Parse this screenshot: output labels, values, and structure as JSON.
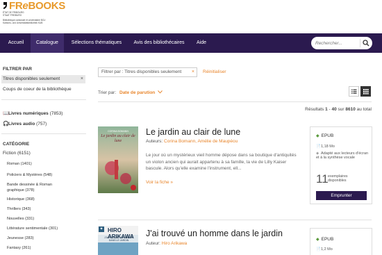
{
  "header": {
    "logo_text_a": "FR",
    "logo_text_e": "e",
    "logo_text_b": "BOOKS",
    "subtitle_lines": [
      "ÉTAT DE FRIBOURG",
      "STAAT FREIBURG",
      "Bibliothèque cantonale et universitaire BCU",
      "Kantons- und Universitätsbibliothek KUB"
    ]
  },
  "nav": {
    "items": [
      "Accueil",
      "Catalogue",
      "Sélections thématiques",
      "Avis des bibliothécaires",
      "Aide"
    ],
    "active": "Catalogue"
  },
  "search": {
    "placeholder": "Rechercher..."
  },
  "sidebar": {
    "filter_heading": "FILTRER PAR",
    "active_filter": "Titres disponibles seulement",
    "remove": "×",
    "favorites": "Coups de coeur de la bibliothèque",
    "formats": [
      {
        "label": "Livres numériques",
        "count": "(7853)"
      },
      {
        "label": "Livres audio",
        "count": "(757)"
      }
    ],
    "category_heading": "CATÉGORIE",
    "category_root": "Fiction (6151)",
    "categories": [
      "Roman (1401)",
      "Policiers & Mystères (548)",
      "Bande dessinée & Roman",
      "graphique (378)",
      "Historique (368)",
      "Thrillers (343)",
      "Nouvelles (331)",
      "Littérature sentimentale (301)",
      "Jeunesse (283)",
      "Fantasy (261)"
    ]
  },
  "filterbar": {
    "chip": "Filtrer par : Titres disponibles seulement",
    "chip_remove": "×",
    "reset": "Réinitialiser"
  },
  "sort": {
    "label": "Trier par:",
    "value": "Date de parution"
  },
  "results": {
    "prefix": "Résultats",
    "from": "1",
    "to": "40",
    "sep": "-",
    "on": "sur",
    "total": "8610",
    "suffix": "au total"
  },
  "books": [
    {
      "title": "Le jardin au clair de lune",
      "authors_label": "Auteurs:",
      "authors": "Corina Bomann, Amélie de Maupéou",
      "summary": "Le jour où un mystérieux vieil homme dépose dans sa boutique d'antiquités un violon ancien qui aurait appartenu à sa famille, la vie de Lilly Kaiser bascule. Alors qu'elle examine l'instrument, ell...",
      "more": "Voir la fiche »",
      "cover": {
        "author": "CORINA BOMANN",
        "title": "Le jardin au clair de lune"
      },
      "avail": {
        "format": "EPUB",
        "size": "1,18 Mo",
        "access": "Adapté aux lecteurs d'écran et à la synthèse vocale",
        "count": "11",
        "count_label": "exemplaires disponibles",
        "button": "Emprunter"
      }
    },
    {
      "title": "J'ai trouvé un homme dans le jardin",
      "authors_label": "Auteur:",
      "authors": "Hiro Arikawa",
      "cover": {
        "author": "HIRO ARIKAWA",
        "title": "J'AI TROUVÉ UN HOMME DANS LE JARDIN"
      },
      "avail": {
        "format": "EPUB",
        "size": "1,2 Mo"
      }
    }
  ],
  "colors": {
    "brand": "#2b1a4f",
    "accent": "#e8852b",
    "green": "#5a9a3b"
  }
}
